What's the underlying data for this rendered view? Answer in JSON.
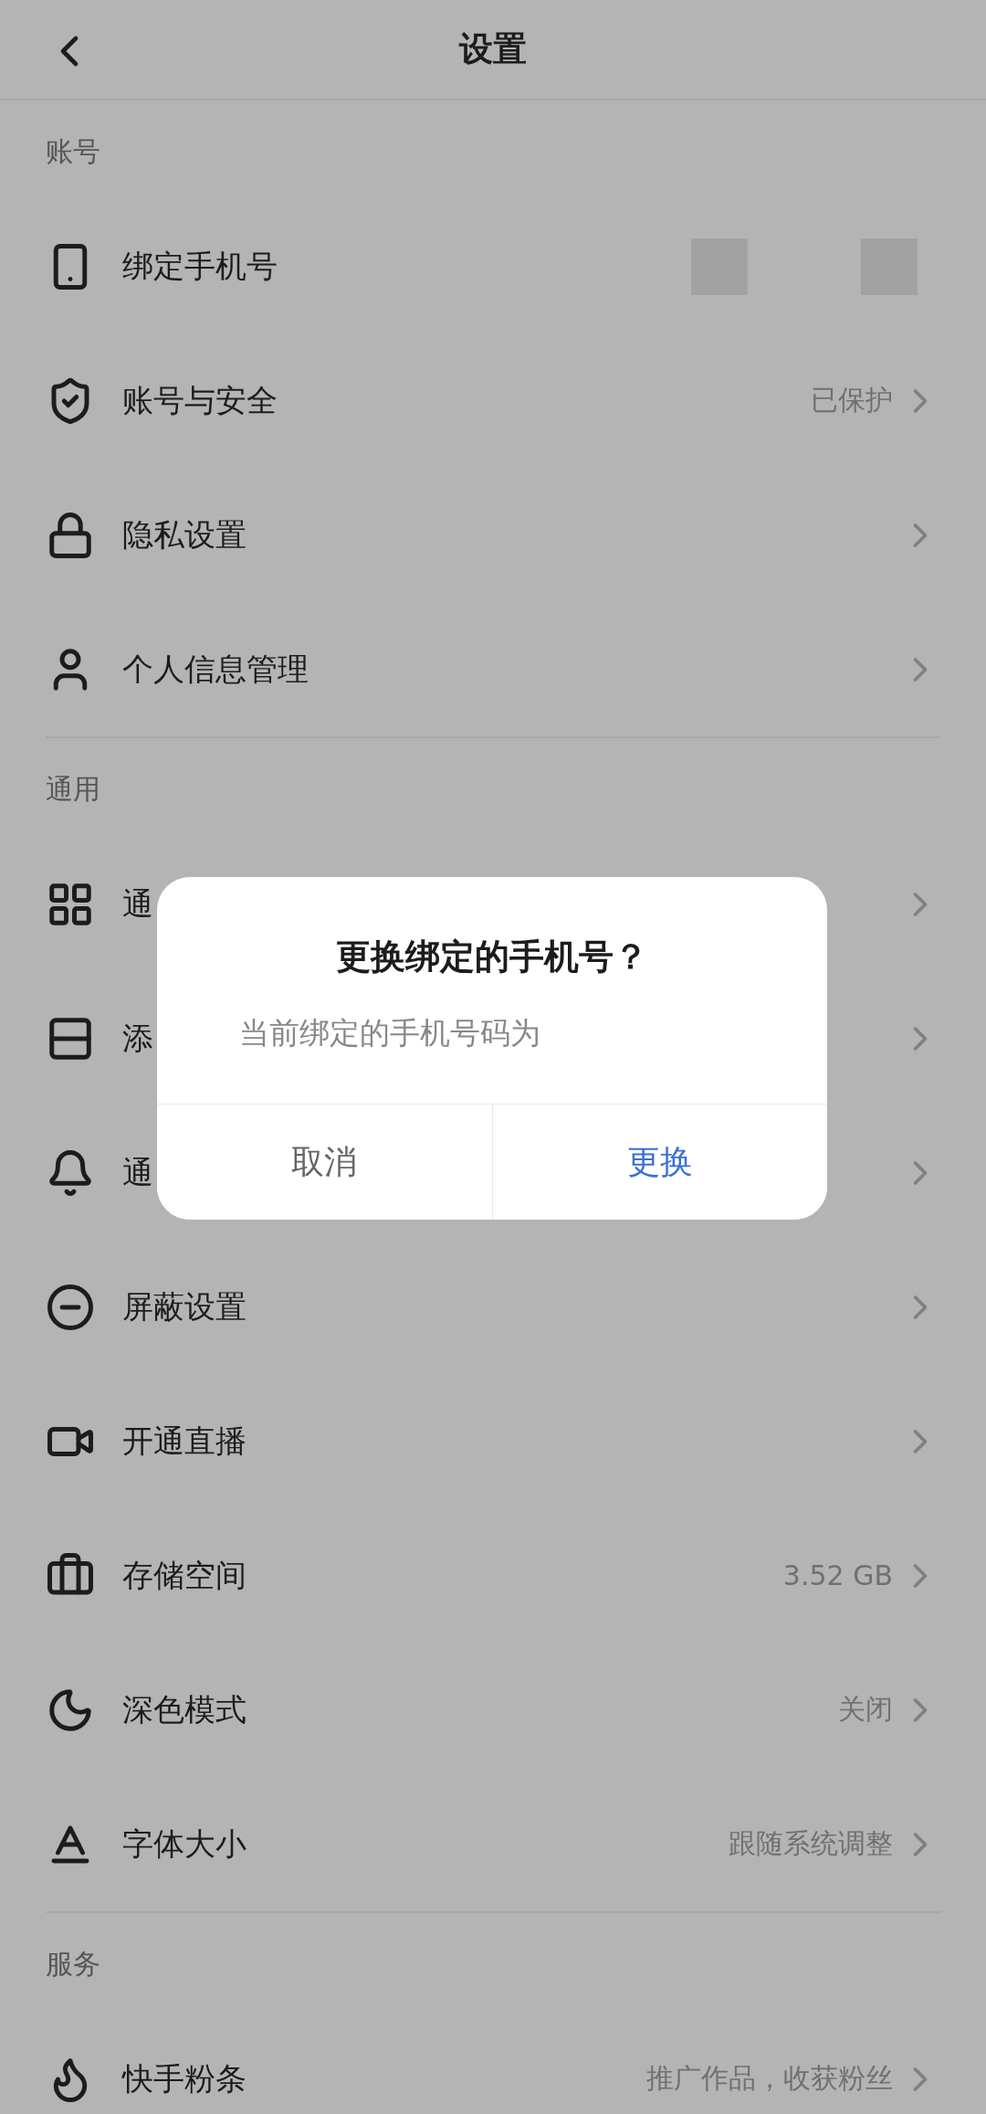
{
  "header": {
    "title": "设置"
  },
  "sections": [
    {
      "title": "账号",
      "items": [
        {
          "kind": "masked",
          "label": "绑定手机号"
        },
        {
          "kind": "link",
          "label": "账号与安全",
          "value": "已保护"
        },
        {
          "kind": "link",
          "label": "隐私设置"
        },
        {
          "kind": "link",
          "label": "个人信息管理"
        }
      ]
    },
    {
      "title": "通用",
      "items": [
        {
          "kind": "link",
          "label": "通"
        },
        {
          "kind": "link",
          "label": "添"
        },
        {
          "kind": "link",
          "label": "通"
        },
        {
          "kind": "link",
          "label": "屏蔽设置"
        },
        {
          "kind": "link",
          "label": "开通直播"
        },
        {
          "kind": "link",
          "label": "存储空间",
          "value": "3.52 GB"
        },
        {
          "kind": "link",
          "label": "深色模式",
          "value": "关闭"
        },
        {
          "kind": "link",
          "label": "字体大小",
          "value": "跟随系统调整"
        }
      ]
    },
    {
      "title": "服务",
      "items": [
        {
          "kind": "link",
          "label": "快手粉条",
          "value": "推广作品，收获粉丝"
        }
      ]
    }
  ],
  "dialog": {
    "title": "更换绑定的手机号？",
    "message": "当前绑定的手机号码为",
    "buttons": [
      {
        "label": "取消",
        "primary": false
      },
      {
        "label": "更换",
        "primary": true
      }
    ]
  }
}
